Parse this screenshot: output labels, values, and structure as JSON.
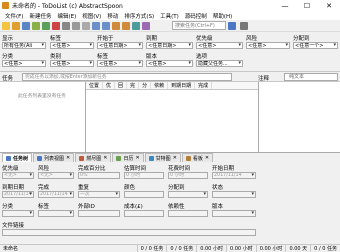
{
  "window": {
    "title": "未命名的 - ToDoList (c) AbstractSpoon"
  },
  "menu": [
    "文件(F)",
    "新建任务",
    "编辑(E)",
    "视图(V)",
    "移动",
    "排序方式(S)",
    "工具(T)",
    "源码控制",
    "帮助(H)"
  ],
  "toolbar": {
    "search_placeholder": "搜索任务(Ctrl+F)"
  },
  "filters": {
    "row1": [
      {
        "label": "显示",
        "value": "所有任务(Ali"
      },
      {
        "label": "标签",
        "value": "<任意>"
      },
      {
        "label": "开始于",
        "value": "<任意日期>"
      },
      {
        "label": "到期",
        "value": "<任意日期>"
      },
      {
        "label": "优先级",
        "value": "<任意>"
      },
      {
        "label": "风险",
        "value": "<任意>"
      },
      {
        "label": "分配到",
        "value": "<任意一个>"
      }
    ],
    "row2": [
      {
        "label": "分类",
        "value": "<任意>"
      },
      {
        "label": "类别",
        "value": "<任意>"
      },
      {
        "label": "标签",
        "value": "<任意>"
      },
      {
        "label": "版本",
        "value": "<任意>"
      },
      {
        "label": "选项",
        "value": "隐藏父任务..."
      }
    ]
  },
  "tasklist": {
    "label": "任务",
    "input_placeholder": "完成任务以添加,或按Enter添加新任务",
    "comment_label": "注释",
    "comment_format": "纯文本",
    "empty_hint": "此任务列表里没有任务"
  },
  "columns": [
    "位置",
    "优",
    "回",
    "完",
    "分",
    "依赖",
    "到期日期",
    "完成"
  ],
  "tabs": [
    {
      "label": "任务树",
      "active": true
    },
    {
      "label": "列表视图"
    },
    {
      "label": "燃尽图"
    },
    {
      "label": "日历"
    },
    {
      "label": "甘特图"
    },
    {
      "label": "看板"
    }
  ],
  "properties": {
    "row1": [
      {
        "label": "优先级",
        "value": "<无>"
      },
      {
        "label": "风险",
        "value": "<无>"
      },
      {
        "label": "完成百分比",
        "value": "0%"
      },
      {
        "label": "估算时间",
        "value": "0 小时"
      },
      {
        "label": "花费时间",
        "value": "0 小时"
      },
      {
        "label": "开始日期",
        "value": "2017/11/14"
      }
    ],
    "row2": [
      {
        "label": "到期日期",
        "value": "2017/11/14"
      },
      {
        "label": "完成",
        "value": "2017/11/14"
      },
      {
        "label": "重复",
        "value": "一次"
      },
      {
        "label": "颜色",
        "value": ""
      },
      {
        "label": "分配到",
        "value": ""
      },
      {
        "label": "状态",
        "value": ""
      }
    ],
    "row3": [
      {
        "label": "分类",
        "value": ""
      },
      {
        "label": "标签",
        "value": ""
      },
      {
        "label": "外部ID",
        "value": ""
      },
      {
        "label": "成本(£)",
        "value": ""
      },
      {
        "label": "依赖性",
        "value": ""
      },
      {
        "label": "版本",
        "value": ""
      }
    ],
    "row4_label": "文件链接"
  },
  "status": {
    "filename": "未命名",
    "cols": [
      "0 / 0 任务",
      "0 / 0 任务",
      "0.00 小时",
      "0.00 小时",
      "0.00 小时",
      "0.00 天",
      "0 / 0 任务"
    ]
  }
}
